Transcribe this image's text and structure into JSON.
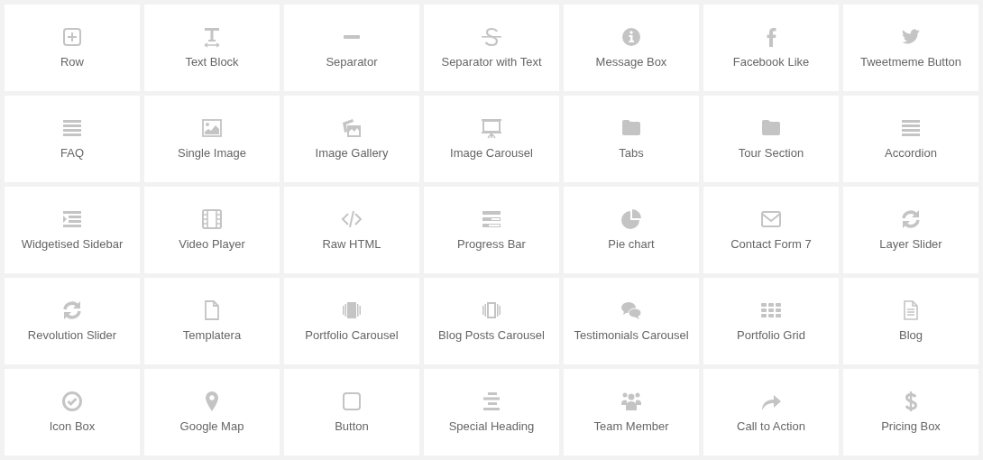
{
  "elements": [
    {
      "label": "Row",
      "kind": "plus"
    },
    {
      "label": "Text Block",
      "kind": "textsize"
    },
    {
      "label": "Separator",
      "kind": "minus"
    },
    {
      "label": "Separator with Text",
      "kind": "strike"
    },
    {
      "label": "Message Box",
      "kind": "info"
    },
    {
      "label": "Facebook Like",
      "kind": "flogo"
    },
    {
      "label": "Tweetmeme Button",
      "kind": "bird"
    },
    {
      "label": "FAQ",
      "kind": "lines"
    },
    {
      "label": "Single Image",
      "kind": "image"
    },
    {
      "label": "Image Gallery",
      "kind": "gallery"
    },
    {
      "label": "Image Carousel",
      "kind": "easel"
    },
    {
      "label": "Tabs",
      "kind": "folder"
    },
    {
      "label": "Tour Section",
      "kind": "folder"
    },
    {
      "label": "Accordion",
      "kind": "lines"
    },
    {
      "label": "Widgetised Sidebar",
      "kind": "indent"
    },
    {
      "label": "Video Player",
      "kind": "film"
    },
    {
      "label": "Raw HTML",
      "kind": "code"
    },
    {
      "label": "Progress Bar",
      "kind": "bars"
    },
    {
      "label": "Pie chart",
      "kind": "pie"
    },
    {
      "label": "Contact Form 7",
      "kind": "envelope"
    },
    {
      "label": "Layer Slider",
      "kind": "refresh"
    },
    {
      "label": "Revolution Slider",
      "kind": "refresh"
    },
    {
      "label": "Templatera",
      "kind": "file"
    },
    {
      "label": "Portfolio Carousel",
      "kind": "frames"
    },
    {
      "label": "Blog Posts Carousel",
      "kind": "slides"
    },
    {
      "label": "Testimonials Carousel",
      "kind": "chat"
    },
    {
      "label": "Portfolio Grid",
      "kind": "grid"
    },
    {
      "label": "Blog",
      "kind": "document"
    },
    {
      "label": "Icon Box",
      "kind": "check"
    },
    {
      "label": "Google Map",
      "kind": "pin"
    },
    {
      "label": "Button",
      "kind": "square"
    },
    {
      "label": "Special Heading",
      "kind": "align"
    },
    {
      "label": "Team Member",
      "kind": "users"
    },
    {
      "label": "Call to Action",
      "kind": "share"
    },
    {
      "label": "Pricing Box",
      "kind": "dollar"
    }
  ]
}
